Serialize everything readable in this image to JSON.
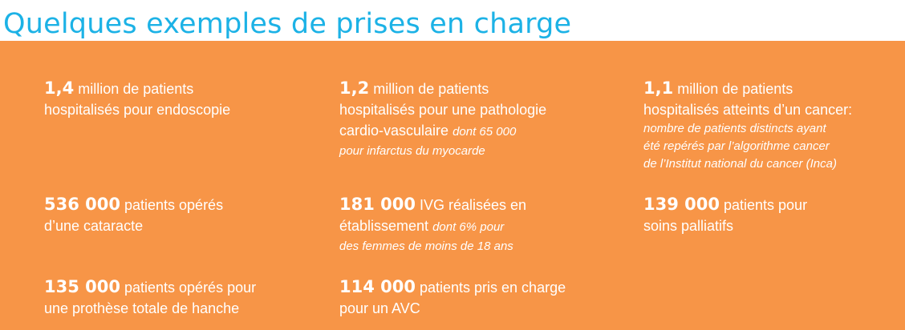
{
  "title": "Quelques exemples de prises en charge",
  "colors": {
    "title": "#1cb2e6",
    "panel": "#f79547",
    "text": "#ffffff"
  },
  "stats": [
    {
      "number": "1,4",
      "line1": " million de patients",
      "line2": "hospitalisés pour endoscopie"
    },
    {
      "number": "1,2",
      "line1": " million de patients",
      "line2": "hospitalisés pour une pathologie",
      "line3": "cardio-vasculaire ",
      "note1": "dont 65 000",
      "note2": "pour infarctus du myocarde"
    },
    {
      "number": "1,1",
      "line1": " million de patients",
      "line2": "hospitalisés atteints d’un cancer:",
      "note1": "nombre de patients distincts ayant",
      "note2": "été repérés par l’algorithme cancer",
      "note3": "de l’Institut national du cancer (Inca)"
    },
    {
      "number": "536 000",
      "line1": " patients opérés",
      "line2": "d’une cataracte"
    },
    {
      "number": "181 000",
      "line1": " IVG réalisées en",
      "line2": "établissement ",
      "note1": "dont 6% pour",
      "note2": "des femmes de moins de 18 ans"
    },
    {
      "number": "139 000",
      "line1": " patients pour",
      "line2": "soins palliatifs"
    },
    {
      "number": "135 000",
      "line1": " patients opérés pour",
      "line2": "une prothèse totale de hanche"
    },
    {
      "number": "114 000",
      "line1": " patients pris en charge",
      "line2": "pour un AVC"
    }
  ]
}
